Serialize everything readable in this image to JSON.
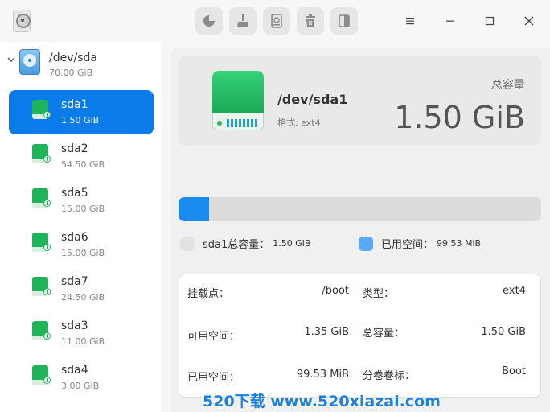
{
  "toolbar": {
    "buttons": [
      {
        "name": "partition-icon"
      },
      {
        "name": "clean-icon"
      },
      {
        "name": "disk-info-icon"
      },
      {
        "name": "delete-icon"
      },
      {
        "name": "resize-icon"
      }
    ]
  },
  "window_controls": [
    "menu-icon",
    "minimize-icon",
    "maximize-icon",
    "close-icon"
  ],
  "sidebar": {
    "disk": {
      "name": "/dev/sda",
      "size": "70.00 GiB"
    },
    "partitions": [
      {
        "name": "sda1",
        "size": "1.50 GiB",
        "selected": true
      },
      {
        "name": "sda2",
        "size": "54.50 GiB",
        "selected": false
      },
      {
        "name": "sda5",
        "size": "15.00 GiB",
        "selected": false
      },
      {
        "name": "sda6",
        "size": "15.00 GiB",
        "selected": false
      },
      {
        "name": "sda7",
        "size": "24.50 GiB",
        "selected": false
      },
      {
        "name": "sda3",
        "size": "11.00 GiB",
        "selected": false
      },
      {
        "name": "sda4",
        "size": "3.00 GiB",
        "selected": false
      }
    ]
  },
  "main": {
    "title": "/dev/sda1",
    "fs_line": "格式: ext4",
    "capacity_label": "总容量",
    "capacity_value": "1.50 GiB",
    "usage_fraction": 0.085,
    "legend": [
      {
        "label": "sda1总容量：",
        "value": "1.50 GiB",
        "color": "#e2e2e2"
      },
      {
        "label": "已用空间：",
        "value": "99.53 MiB",
        "color": "#5aa9f5"
      }
    ],
    "details": {
      "mount_label": "挂载点：",
      "mount_value": "/boot",
      "type_label": "类型：",
      "type_value": "ext4",
      "avail_label": "可用空间：",
      "avail_value": "1.35 GiB",
      "total_label": "总容量：",
      "total_value": "1.50 GiB",
      "used_label": "已用空间：",
      "used_value": "99.53 MiB",
      "vol_label": "分卷卷标：",
      "vol_value": "Boot"
    }
  },
  "watermark": "520下载 www.520xiazai.com",
  "colors": {
    "accent": "#0a7bea",
    "drive_green": "#1fb35a"
  }
}
